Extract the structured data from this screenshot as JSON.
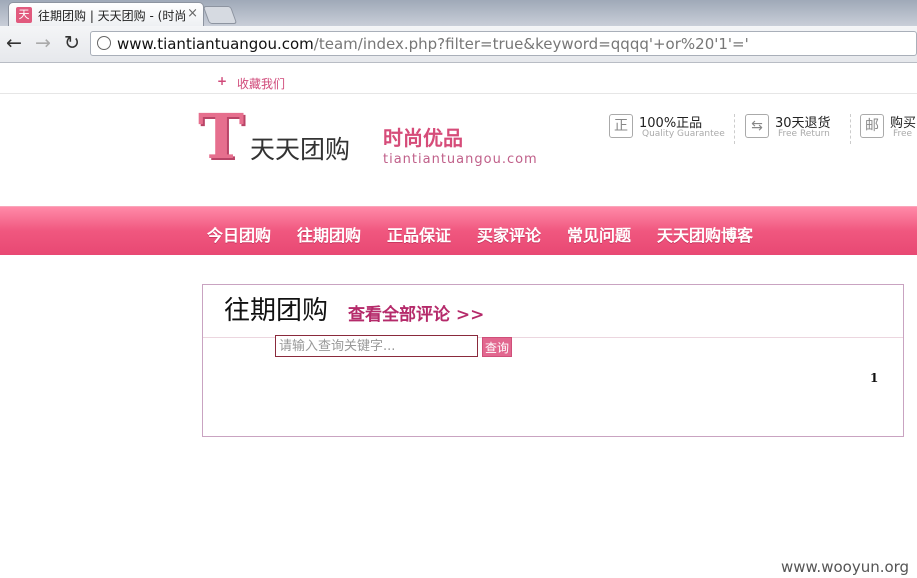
{
  "browser": {
    "tab_title": "往期团购 | 天天团购 - (时尚",
    "tab_favicon": "天",
    "tab_close": "×",
    "url_host": "www.tiantiantuangou.com",
    "url_path": "/team/index.php?filter=true&keyword=qqqq'+or%20'1'='",
    "back_icon": "←",
    "forward_icon": "→",
    "reload_icon": "↻"
  },
  "favorites": {
    "plus": "+",
    "label": "收藏我们"
  },
  "header": {
    "logo_letter": "T",
    "logo_name": "天天团购",
    "slogan": "时尚优品",
    "site_en": "tiantiantuangou.com",
    "promises": [
      {
        "icon": "正",
        "title": "100%正品",
        "subtitle": "Quality Guarantee"
      },
      {
        "icon": "⇆",
        "title": "30天退货",
        "subtitle": "Free Return"
      },
      {
        "icon": "邮",
        "title": "购买",
        "subtitle": "Free"
      }
    ]
  },
  "nav": {
    "items": [
      "今日团购",
      "往期团购",
      "正品保证",
      "买家评论",
      "常见问题",
      "天天团购博客"
    ]
  },
  "main": {
    "title": "往期团购",
    "all_reviews_link": "查看全部评论 >>",
    "search_placeholder": "请输入查询关键字...",
    "search_button": "查询",
    "page_number": "1"
  },
  "watermark": "www.wooyun.org"
}
